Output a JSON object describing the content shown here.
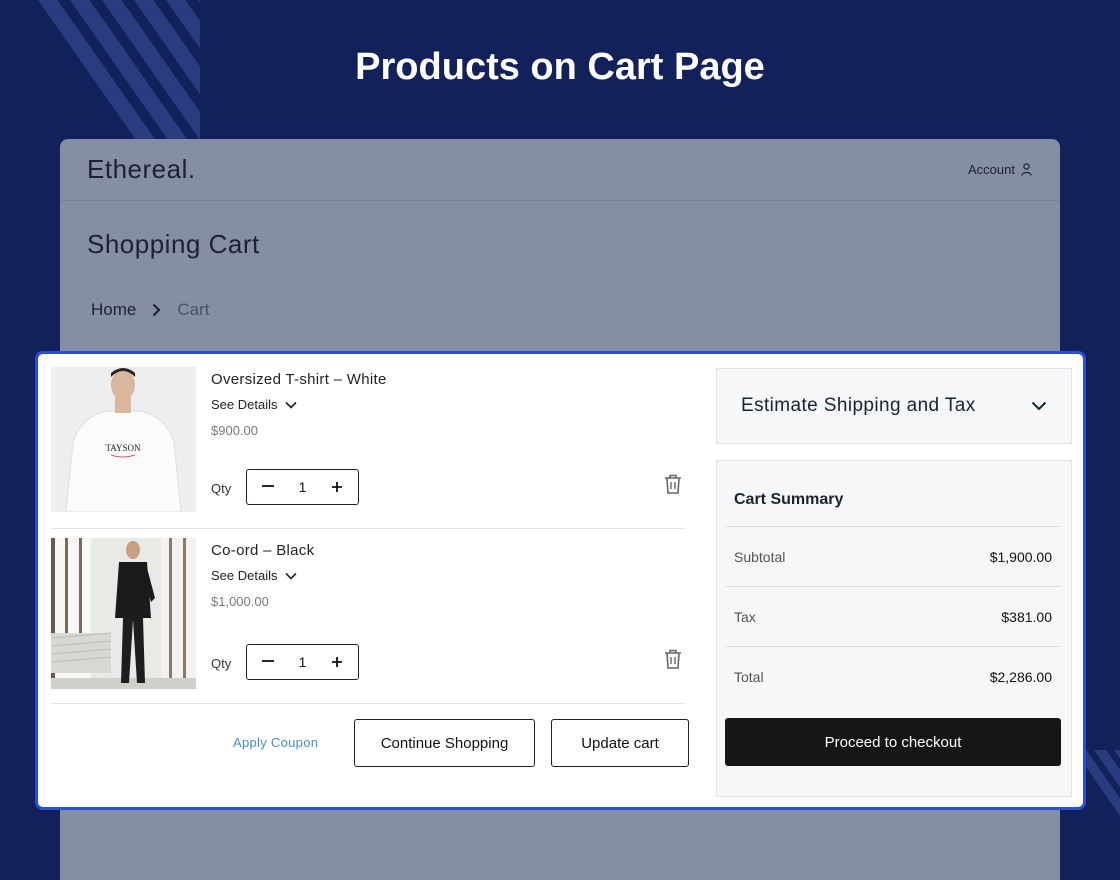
{
  "page": {
    "title": "Products on Cart Page"
  },
  "store": {
    "brand": "Ethereal.",
    "account_label": "Account",
    "heading": "Shopping Cart",
    "breadcrumb": [
      "Home",
      "Cart"
    ]
  },
  "cart": {
    "items": [
      {
        "name": "Oversized T-shirt – White",
        "details_label": "See Details",
        "price": "$900.00",
        "qty_label": "Qty",
        "qty": "1",
        "image_text": "TAYSON"
      },
      {
        "name": "Co-ord – Black",
        "details_label": "See Details",
        "price": "$1,000.00",
        "qty_label": "Qty",
        "qty": "1"
      }
    ],
    "coupon_label": "Apply Coupon",
    "continue_label": "Continue Shopping",
    "update_label": "Update cart"
  },
  "sidebar": {
    "shipping_label": "Estimate Shipping and Tax",
    "summary_title": "Cart Summary",
    "rows": [
      {
        "label": "Subtotal",
        "value": "$1,900.00"
      },
      {
        "label": "Tax",
        "value": "$381.00"
      },
      {
        "label": "Total",
        "value": "$2,286.00"
      }
    ],
    "checkout_label": "Proceed to checkout"
  },
  "colors": {
    "background": "#13215a",
    "highlight_border": "#2a4fd8",
    "coupon_link": "#4a90c8",
    "checkout_button": "#161616"
  },
  "icons": [
    "user-icon",
    "chevron-right-icon",
    "chevron-down-icon",
    "minus-icon",
    "plus-icon",
    "trash-icon"
  ]
}
